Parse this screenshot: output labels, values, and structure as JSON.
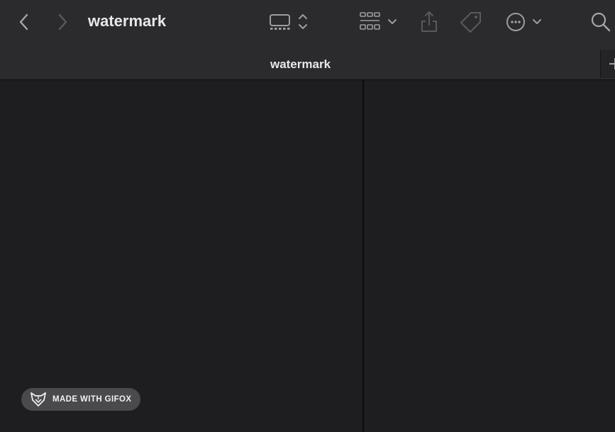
{
  "toolbar": {
    "title": "watermark",
    "icons": {
      "back": "chevron-left-icon",
      "forward": "chevron-right-icon",
      "view_mode": "gallery-view-icon",
      "view_mode_arrows": "chevron-up-down-icon",
      "group": "grid-group-icon",
      "group_chevron": "chevron-down-icon",
      "share": "share-icon",
      "tag": "tag-icon",
      "more": "ellipsis-circle-icon",
      "more_chevron": "chevron-down-icon",
      "search": "search-icon"
    }
  },
  "tabbar": {
    "active_tab": "watermark",
    "new_tab_icon": "plus-icon"
  },
  "watermark_badge": {
    "label": "MADE WITH GIFOX",
    "icon": "fox-logo-icon"
  },
  "colors": {
    "toolbar_bg": "#2b2b2d",
    "content_bg": "#1e1e20",
    "icon": "#8e8e93",
    "icon_disabled": "#5a5a5e",
    "text": "#e8e8ea"
  }
}
